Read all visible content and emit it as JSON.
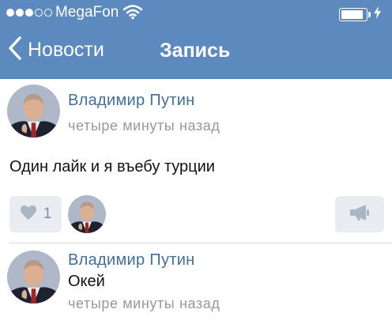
{
  "status_bar": {
    "carrier": "MegaFon",
    "signal_strength": 3,
    "signal_max": 5,
    "battery_level": 0.9,
    "icons": [
      "signal-dots-icon",
      "wifi-icon",
      "battery-icon",
      "charging-bolt-icon"
    ]
  },
  "nav": {
    "back_label": "Новости",
    "title": "Запись",
    "back_icon": "chevron-left-icon"
  },
  "colors": {
    "header_bg": "#5c89be",
    "author_link": "#3f6f9d",
    "muted_text": "#8f9aa6",
    "button_bg": "#e9edf1",
    "button_icon": "#a9b6c4"
  },
  "post": {
    "author": "Владимир Путин",
    "time": "четыре минуты назад",
    "text": "Один лайк и я въебу турции",
    "likes": "1",
    "like_icon": "heart-icon",
    "share_icon": "megaphone-icon"
  },
  "comment": {
    "author": "Владимир Путин",
    "text": "Окей",
    "time": "четыре минуты назад"
  }
}
